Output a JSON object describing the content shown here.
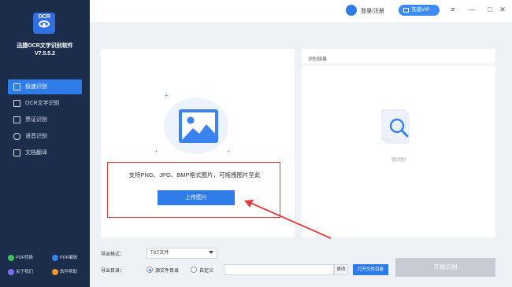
{
  "sidebar": {
    "logo_text": "OCR",
    "app_name": "迅捷OCR文字识别软件",
    "version": "V7.5.5.2",
    "items": [
      {
        "label": "极速识别",
        "icon": "lightning-doc-icon",
        "active": true
      },
      {
        "label": "OCR文字识别",
        "icon": "ocr-scan-icon",
        "active": false
      },
      {
        "label": "票证识别",
        "icon": "ticket-icon",
        "active": false
      },
      {
        "label": "语音识别",
        "icon": "microphone-icon",
        "active": false
      },
      {
        "label": "文档翻译",
        "icon": "translate-icon",
        "active": false
      }
    ],
    "bottom_links": [
      {
        "label": "PDF转换",
        "color": "#3fbf5f"
      },
      {
        "label": "PDF编辑",
        "color": "#3b7ff0"
      },
      {
        "label": "关于我们",
        "color": "#7a6df0"
      },
      {
        "label": "软件帮助",
        "color": "#f29b2b"
      }
    ]
  },
  "topbar": {
    "login_label": "登录/注册",
    "vip_label": "充值VIP"
  },
  "upload": {
    "hint": "支持PNG、JPG、BMP格式图片，可拖拽图片至此",
    "button_label": "上传图片"
  },
  "result": {
    "title": "识别结果",
    "waiting_label": "待识别"
  },
  "export": {
    "format_label": "导出格式：",
    "format_value": "TXT文件",
    "dir_label": "导出目录：",
    "dir_options": [
      {
        "label": "源文件目录",
        "selected": true
      },
      {
        "label": "自定义",
        "selected": false
      }
    ],
    "change_label": "更改",
    "open_folder_label": "打开文件目录"
  },
  "start_button_label": "开始识别",
  "colors": {
    "accent": "#2f7be8",
    "sidebar_bg": "#1b2d4a",
    "highlight_border": "#e33b3b",
    "disabled_button": "#c7ccd4"
  }
}
